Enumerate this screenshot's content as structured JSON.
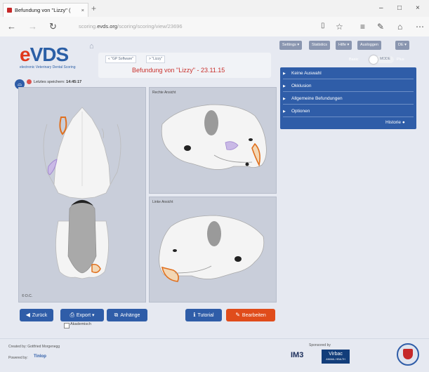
{
  "browser": {
    "tab_title": "Befundung von \"Lizzy\" (",
    "tab_close": "×",
    "new_tab": "+",
    "win_minimize": "–",
    "win_maximize": "□",
    "win_close": "×",
    "url_prefix": "scoring.",
    "url_domain": "evds.org",
    "url_path": "/scoring/scoring/view/23696",
    "toolbar_icons": [
      "reading-view-icon",
      "favorites-star-icon",
      "hub-icon",
      "notes-icon",
      "share-icon",
      "more-icon"
    ]
  },
  "brand": {
    "logo_e": "e",
    "logo_text": "VDS",
    "subtitle": "electronic Veterinary Dental Scoring"
  },
  "breadcrumbs": [
    "« \"GP Software\"",
    "> \"Lizzy\""
  ],
  "page_title": "Befundung von \"Lizzy\" - 23.11.15",
  "topnav": [
    "Settings ▾",
    "Statistics",
    "Hilfe ▾",
    "Ausloggen",
    "DE ▾"
  ],
  "mode_toggle": {
    "left": "Basic",
    "knob_text": "MODE",
    "right": "Plus"
  },
  "accordion": [
    {
      "label": "Keine Auswahl"
    },
    {
      "label": "Okklusion"
    },
    {
      "label": "Allgemeine Befundungen"
    },
    {
      "label": "Optionen"
    }
  ],
  "historie_label": "Historie",
  "save_status": {
    "label": "Letztes speichern:",
    "time": "14:45:17"
  },
  "panels": {
    "right_view_label": "Rechte Ansicht",
    "left_view_label": "Linke Ansicht",
    "dental_chart_label": "© D.C."
  },
  "buttons": {
    "back": "Zurück",
    "export": "Export",
    "attachments": "Anhänge",
    "tutorial": "Tutorial",
    "edit": "Bearbeiten",
    "academic": "Akademisch"
  },
  "footer": {
    "created_by": "Created by: Gottfried Morgenegg",
    "powered_by": "Powered by:",
    "powered_logo": "Tinlop",
    "sponsored_by": "Sponsored by",
    "sponsor1": "IM3",
    "sponsor2": "Virbac",
    "sponsor2_sub": "ANIMAL HEALTH"
  },
  "colors": {
    "brand_blue": "#2b5fa6",
    "brand_red": "#e0381b",
    "accordion_bg": "#2f5da8",
    "button_blue": "#2f5da8",
    "button_red": "#e04c1b",
    "lesion_orange": "#e0701e",
    "lesion_purple": "#a38ad1"
  }
}
